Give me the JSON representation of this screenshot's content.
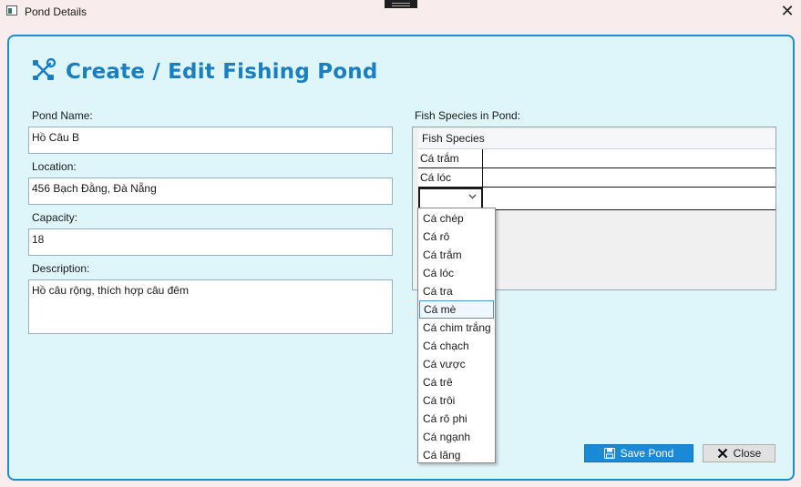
{
  "window": {
    "title": "Pond Details",
    "close_glyph": "✕"
  },
  "header": {
    "icon": "tools-icon",
    "title": "Create / Edit Fishing Pond",
    "accent": "#1a7fc1"
  },
  "form": {
    "pond_name": {
      "label": "Pond Name:",
      "value": "Hồ Câu B"
    },
    "location": {
      "label": "Location:",
      "value": "456 Bạch Đằng, Đà Nẵng"
    },
    "capacity": {
      "label": "Capacity:",
      "value": "18"
    },
    "description": {
      "label": "Description:",
      "value": "Hồ câu rộng, thích hợp câu đêm"
    }
  },
  "species": {
    "label": "Fish Species in Pond:",
    "column": "Fish Species",
    "rows": [
      "Cá trắm",
      "Cá lóc"
    ],
    "dropdown_options": [
      "Cá chép",
      "Cá rô",
      "Cá trắm",
      "Cá lóc",
      "Cá tra",
      "Cá mè",
      "Cá chim trắng",
      "Cá chạch",
      "Cá vược",
      "Cá trê",
      "Cá trôi",
      "Cá rô phi",
      "Cá ngạnh",
      "Cá lăng"
    ],
    "highlighted_option": "Cá mè"
  },
  "buttons": {
    "save": "Save Pond",
    "close": "Close"
  },
  "colors": {
    "card_border": "#1b8fca",
    "card_bg": "#def5f9",
    "save_bg": "#1a8ad8"
  }
}
